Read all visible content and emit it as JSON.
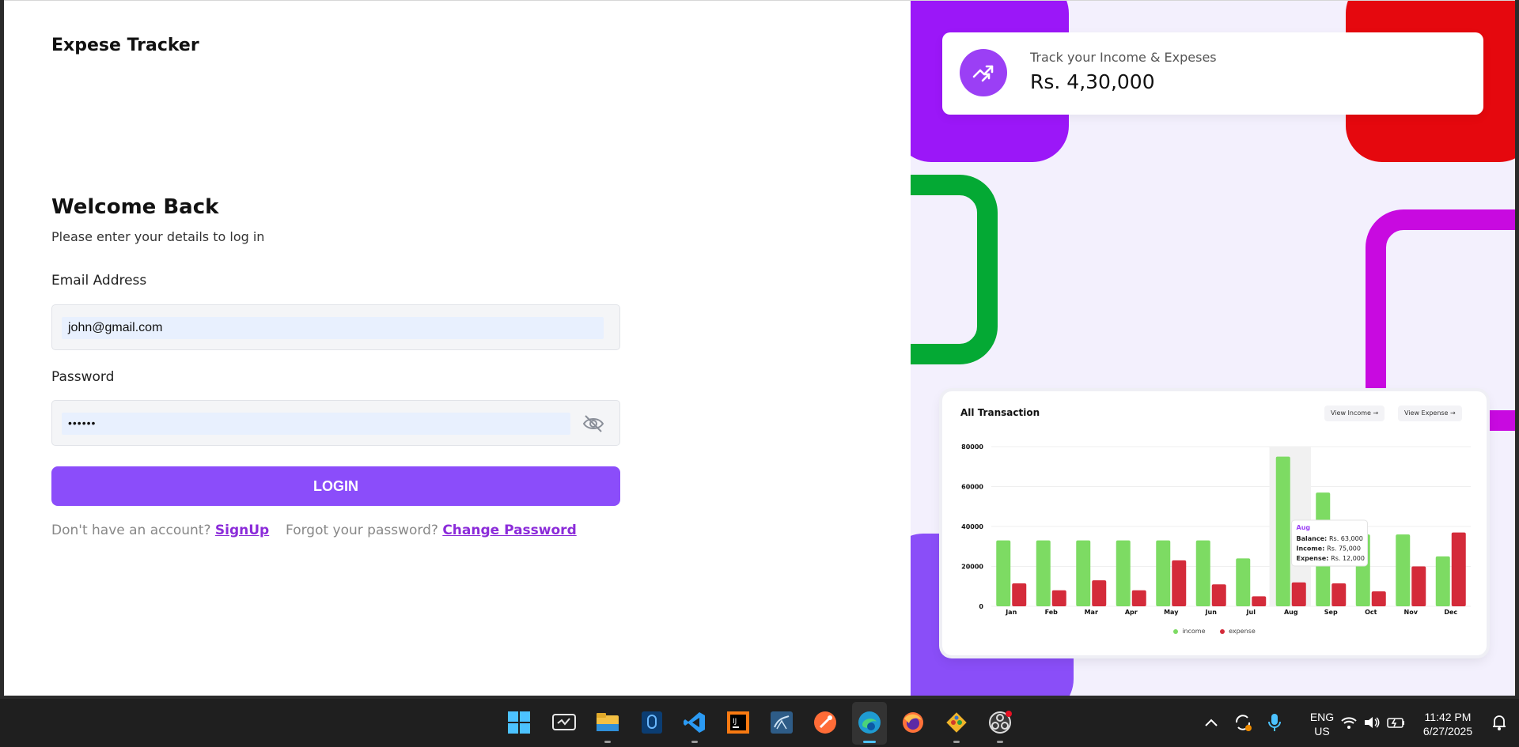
{
  "app": {
    "brand": "Expese Tracker",
    "welcome_title": "Welcome Back",
    "welcome_subtitle": "Please enter your details to log in",
    "email_label": "Email Address",
    "email_value": "john@gmail.com",
    "password_label": "Password",
    "password_value": "••••••",
    "login_label": "LOGIN",
    "no_account_text": "Don't have an account?",
    "signup_link": "SignUp",
    "forgot_text": "Forgot your password?",
    "change_password_link": "Change Password"
  },
  "stat_card": {
    "label": "Track your Income & Expeses",
    "value": "Rs. 4,30,000",
    "icon": "trending-up-icon"
  },
  "chart_card": {
    "title": "All Transaction",
    "view_income": "View Income",
    "view_expense": "View Expense",
    "legend_income": "income",
    "legend_expense": "expense",
    "tooltip": {
      "month": "Aug",
      "balance_label": "Balance:",
      "balance_value": "Rs. 63,000",
      "income_label": "Income:",
      "income_value": "Rs. 75,000",
      "expense_label": "Expense:",
      "expense_value": "Rs. 12,000"
    }
  },
  "chart_data": {
    "type": "bar",
    "title": "All Transaction",
    "categories": [
      "Jan",
      "Feb",
      "Mar",
      "Apr",
      "May",
      "Jun",
      "Jul",
      "Aug",
      "Sep",
      "Oct",
      "Nov",
      "Dec"
    ],
    "series": [
      {
        "name": "income",
        "color": "#7ddb63",
        "values": [
          33000,
          33000,
          33000,
          33000,
          33000,
          33000,
          24000,
          75000,
          57000,
          36000,
          36000,
          25000
        ]
      },
      {
        "name": "expense",
        "color": "#d42b3a",
        "values": [
          11500,
          8000,
          13000,
          8000,
          23000,
          11000,
          5000,
          12000,
          11500,
          7500,
          20000,
          37000
        ]
      }
    ],
    "yticks": [
      "0",
      "20000",
      "40000",
      "60000",
      "80000"
    ],
    "ylim": [
      0,
      80000
    ],
    "highlight_category": "Aug",
    "grid": true,
    "legend_position": "bottom-center"
  },
  "taskbar": {
    "lang_top": "ENG",
    "lang_bottom": "US",
    "time": "11:42 PM",
    "date": "6/27/2025"
  },
  "colors": {
    "accent": "#8b4dfa",
    "link": "#8b2bd9",
    "income": "#7ddb63",
    "expense": "#d42b3a"
  }
}
